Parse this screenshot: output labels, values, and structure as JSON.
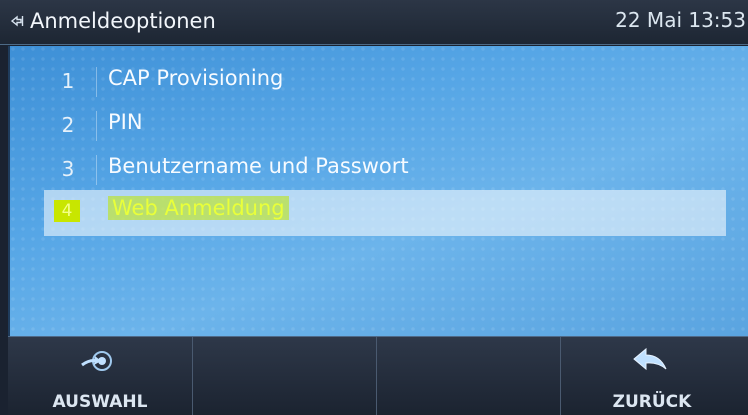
{
  "header": {
    "title": "Anmeldeoptionen",
    "datetime": "22 Mai 13:53",
    "back_icon": "back-arrow-icon"
  },
  "menu": {
    "items": [
      {
        "number": "1",
        "label": "CAP Provisioning"
      },
      {
        "number": "2",
        "label": "PIN"
      },
      {
        "number": "3",
        "label": "Benutzername und Passwort"
      },
      {
        "number": "4",
        "label": "Web Anmeldung",
        "selected": true
      }
    ]
  },
  "softkeys": {
    "select_label": "AUSWAHL",
    "select_icon": "select-arrow-icon",
    "back_label": "ZURÜCK",
    "back_icon": "back-arrow-icon"
  },
  "colors": {
    "background": "#56a6e6",
    "highlight": "#c8e600",
    "header": "#1d2633"
  }
}
